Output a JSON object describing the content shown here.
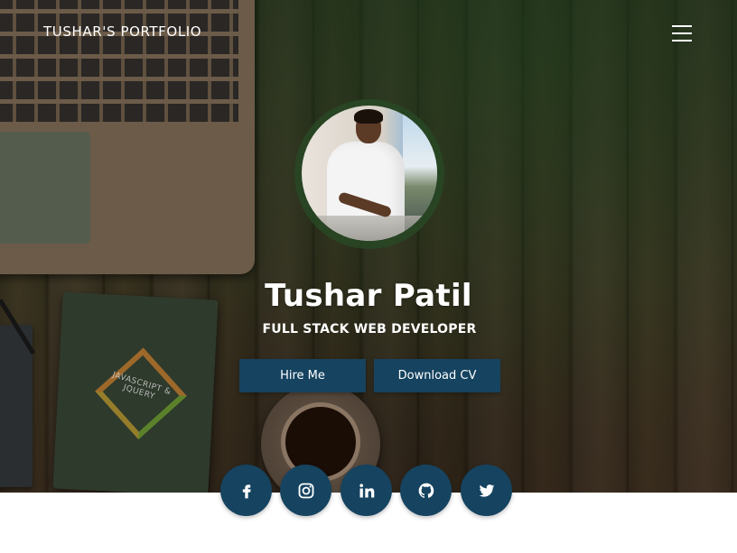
{
  "nav": {
    "brand": "TUSHAR'S PORTFOLIO",
    "menu_icon": "hamburger-menu-icon"
  },
  "hero": {
    "name": "Tushar Patil",
    "role": "FULL STACK WEB DEVELOPER",
    "background": "wooden-desk-with-laptop-book-coffee",
    "book_cover_text": "JAVASCRIPT & JQUERY"
  },
  "buttons": {
    "hire_label": "Hire Me",
    "cv_label": "Download CV"
  },
  "social": [
    {
      "icon": "facebook-icon"
    },
    {
      "icon": "instagram-icon"
    },
    {
      "icon": "linkedin-icon"
    },
    {
      "icon": "github-icon"
    },
    {
      "icon": "twitter-icon"
    }
  ],
  "colors": {
    "accent": "#154360",
    "text": "#ffffff",
    "page_background": "#ffffff"
  }
}
